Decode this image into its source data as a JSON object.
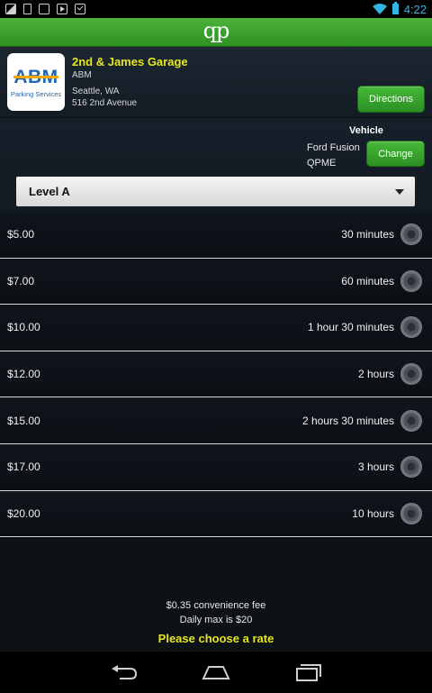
{
  "status_bar": {
    "time": "4:22"
  },
  "title_bar": {
    "logo": "qp"
  },
  "garage": {
    "name": "2nd & James Garage",
    "operator": "ABM",
    "city": "Seattle, WA",
    "address": "516  2nd Avenue",
    "logo_text": "ABM",
    "logo_subtext": "Parking Services",
    "directions_label": "Directions"
  },
  "vehicle": {
    "title": "Vehicle",
    "model": "Ford Fusion",
    "plate": "QPME",
    "change_label": "Change"
  },
  "level_select": {
    "value": "Level A"
  },
  "rates": [
    {
      "price": "$5.00",
      "duration": "30 minutes"
    },
    {
      "price": "$7.00",
      "duration": "60 minutes"
    },
    {
      "price": "$10.00",
      "duration": "1 hour 30 minutes"
    },
    {
      "price": "$12.00",
      "duration": "2 hours"
    },
    {
      "price": "$15.00",
      "duration": "2 hours 30 minutes"
    },
    {
      "price": "$17.00",
      "duration": "3 hours"
    },
    {
      "price": "$20.00",
      "duration": "10 hours"
    }
  ],
  "footer": {
    "fee": "$0.35 convenience fee",
    "daily_max": "Daily max is $20",
    "prompt": "Please choose a rate"
  },
  "colors": {
    "accent_green": "#3aa52d",
    "accent_yellow": "#e6e620",
    "status_blue": "#33b5e5"
  }
}
